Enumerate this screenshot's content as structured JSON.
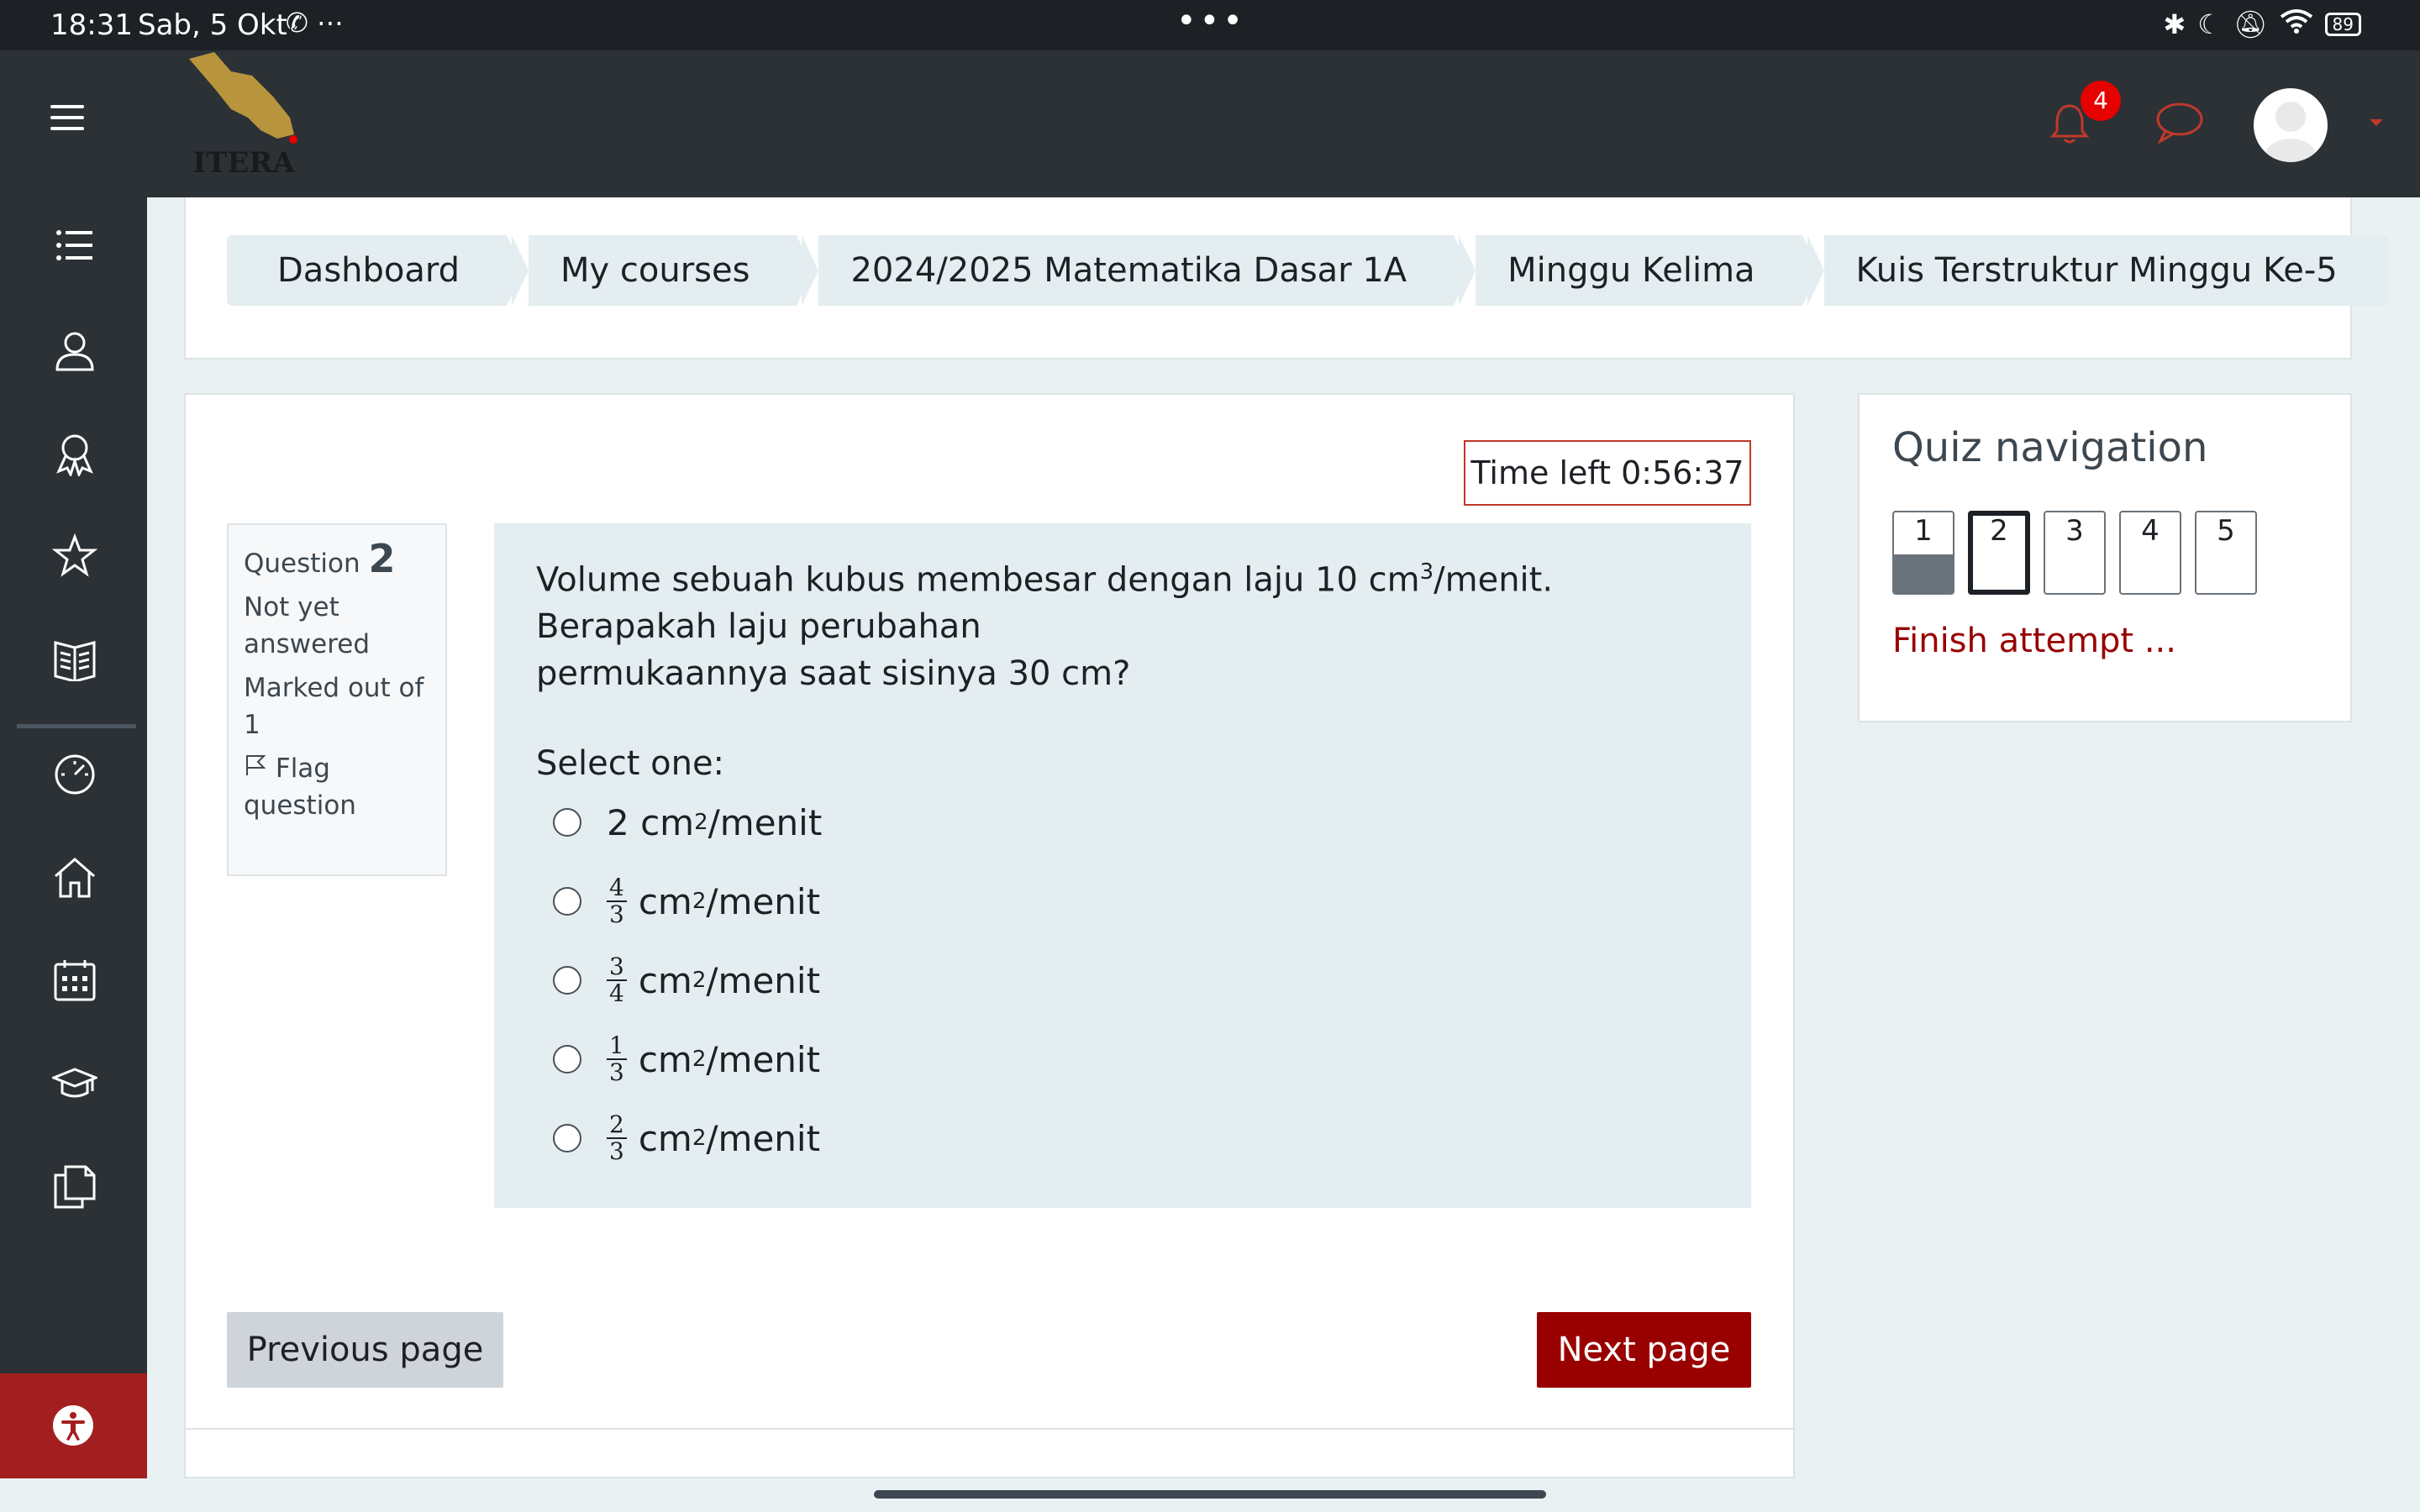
{
  "status_bar": {
    "time": "18:31",
    "date": "Sab, 5 Okt",
    "left_icons": "✆ ⋯",
    "dots": "•••",
    "battery": "89"
  },
  "navbar": {
    "logo_text": "ITERA",
    "notification_count": "4"
  },
  "breadcrumb": [
    "Dashboard",
    "My courses",
    "2024/2025 Matematika Dasar 1A",
    "Minggu Kelima",
    "Kuis Terstruktur Minggu Ke-5"
  ],
  "timer": {
    "label": "Time left 0:56:37"
  },
  "question_info": {
    "label": "Question",
    "number": "2",
    "status": "Not yet answered",
    "marked": "Marked out of 1",
    "flag": "Flag question"
  },
  "question": {
    "text_part1": "Volume sebuah kubus membesar dengan laju 10 cm",
    "text_sup": "3",
    "text_part2": "/menit. Berapakah laju perubahan",
    "text_line3": "permukaannya saat sisinya 30 cm?",
    "select_one": "Select one:",
    "options": [
      {
        "whole": "2",
        "num": "",
        "den": "",
        "unit": "cm",
        "sup": "2",
        "rest": "/menit"
      },
      {
        "whole": "",
        "num": "4",
        "den": "3",
        "unit": "cm",
        "sup": "2",
        "rest": "/menit"
      },
      {
        "whole": "",
        "num": "3",
        "den": "4",
        "unit": "cm",
        "sup": "2",
        "rest": "/menit"
      },
      {
        "whole": "",
        "num": "1",
        "den": "3",
        "unit": "cm",
        "sup": "2",
        "rest": "/menit"
      },
      {
        "whole": "",
        "num": "2",
        "den": "3",
        "unit": "cm",
        "sup": "2",
        "rest": "/menit"
      }
    ]
  },
  "buttons": {
    "previous": "Previous page",
    "next": "Next page"
  },
  "quiz_nav": {
    "title": "Quiz navigation",
    "questions": [
      "1",
      "2",
      "3",
      "4",
      "5"
    ],
    "finish": "Finish attempt ..."
  },
  "colors": {
    "accent": "#990000",
    "sidebar": "#2c3136",
    "panel": "#e4eef1"
  }
}
